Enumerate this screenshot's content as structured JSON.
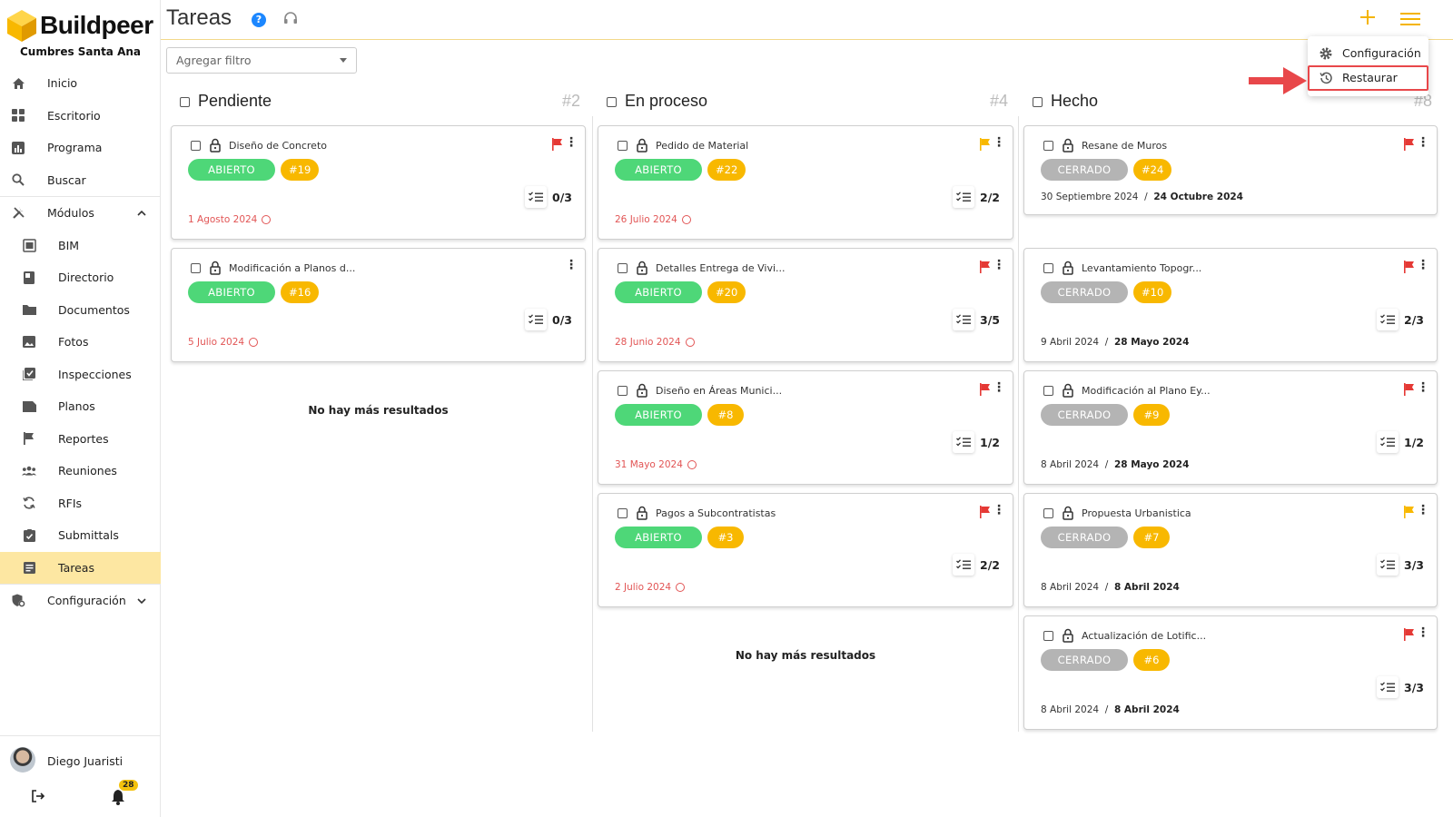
{
  "app": {
    "brand": "Buildpeer",
    "project": "Cumbres Santa Ana",
    "accent_color": "#f8b800",
    "active_color": "#fde7a2"
  },
  "sidebar": {
    "items": [
      {
        "label": "Inicio",
        "icon": "home-icon"
      },
      {
        "label": "Escritorio",
        "icon": "dashboard-icon"
      },
      {
        "label": "Programa",
        "icon": "chart-icon"
      },
      {
        "label": "Buscar",
        "icon": "search-icon"
      },
      {
        "label": "Módulos",
        "icon": "tools-icon"
      },
      {
        "label": "BIM",
        "icon": "bim-icon"
      },
      {
        "label": "Directorio",
        "icon": "book-icon"
      },
      {
        "label": "Documentos",
        "icon": "folder-icon"
      },
      {
        "label": "Fotos",
        "icon": "image-icon"
      },
      {
        "label": "Inspecciones",
        "icon": "checkbox-icon"
      },
      {
        "label": "Planos",
        "icon": "blueprint-icon"
      },
      {
        "label": "Reportes",
        "icon": "flag-icon"
      },
      {
        "label": "Reuniones",
        "icon": "people-icon"
      },
      {
        "label": "RFIs",
        "icon": "sync-icon"
      },
      {
        "label": "Submittals",
        "icon": "clipboard-check-icon"
      },
      {
        "label": "Tareas",
        "icon": "tasks-icon"
      },
      {
        "label": "Configuración",
        "icon": "settings-shield-icon"
      }
    ],
    "user": {
      "name": "Diego Juaristi",
      "notifications": "28"
    }
  },
  "header": {
    "title": "Tareas",
    "help": "?"
  },
  "filter": {
    "placeholder": "Agregar filtro"
  },
  "columns": [
    {
      "title": "Pendiente",
      "count": "#2",
      "no_more": "No hay más resultados",
      "cards": [
        {
          "title": "Diseño de Concreto",
          "status": "ABIERTO",
          "num": "#19",
          "checklist": "0/3",
          "date": "1 Agosto 2024",
          "flag": "#e53935"
        },
        {
          "title": "Modificación a Planos d...",
          "status": "ABIERTO",
          "num": "#16",
          "checklist": "0/3",
          "date": "5 Julio 2024",
          "flag": ""
        }
      ]
    },
    {
      "title": "En proceso",
      "count": "#4",
      "no_more": "No hay más resultados",
      "cards": [
        {
          "title": "Pedido de Material",
          "status": "ABIERTO",
          "num": "#22",
          "checklist": "2/2",
          "date": "26 Julio 2024",
          "flag": "#f8b800"
        },
        {
          "title": "Detalles Entrega de Vivi...",
          "status": "ABIERTO",
          "num": "#20",
          "checklist": "3/5",
          "date": "28 Junio 2024",
          "flag": "#e53935"
        },
        {
          "title": "Diseño en Áreas Munici...",
          "status": "ABIERTO",
          "num": "#8",
          "checklist": "1/2",
          "date": "31 Mayo 2024",
          "flag": "#e53935"
        },
        {
          "title": "Pagos a Subcontratistas",
          "status": "ABIERTO",
          "num": "#3",
          "checklist": "2/2",
          "date": "2 Julio 2024",
          "flag": "#e53935"
        }
      ]
    },
    {
      "title": "Hecho",
      "count": "#8",
      "cards": [
        {
          "title": "Resane de Muros",
          "status": "CERRADO",
          "num": "#24",
          "checklist": "",
          "start": "30 Septiembre 2024",
          "end": "24 Octubre 2024",
          "flag": "#e53935"
        },
        {
          "title": "Levantamiento Topogr...",
          "status": "CERRADO",
          "num": "#10",
          "checklist": "2/3",
          "start": "9 Abril 2024",
          "end": "28 Mayo 2024",
          "flag": "#e53935"
        },
        {
          "title": "Modificación al Plano Ey...",
          "status": "CERRADO",
          "num": "#9",
          "checklist": "1/2",
          "start": "8 Abril 2024",
          "end": "28 Mayo 2024",
          "flag": "#e53935"
        },
        {
          "title": "Propuesta Urbanistica",
          "status": "CERRADO",
          "num": "#7",
          "checklist": "3/3",
          "start": "8 Abril 2024",
          "end": "8 Abril 2024",
          "flag": "#f8b800"
        },
        {
          "title": "Actualización de Lotific...",
          "status": "CERRADO",
          "num": "#6",
          "checklist": "3/3",
          "start": "8 Abril 2024",
          "end": "8 Abril 2024",
          "flag": "#e53935"
        }
      ]
    }
  ],
  "dropdown": {
    "items": [
      {
        "label": "Configuración",
        "icon": "gear-icon"
      },
      {
        "label": "Restaurar",
        "icon": "history-icon"
      }
    ]
  }
}
